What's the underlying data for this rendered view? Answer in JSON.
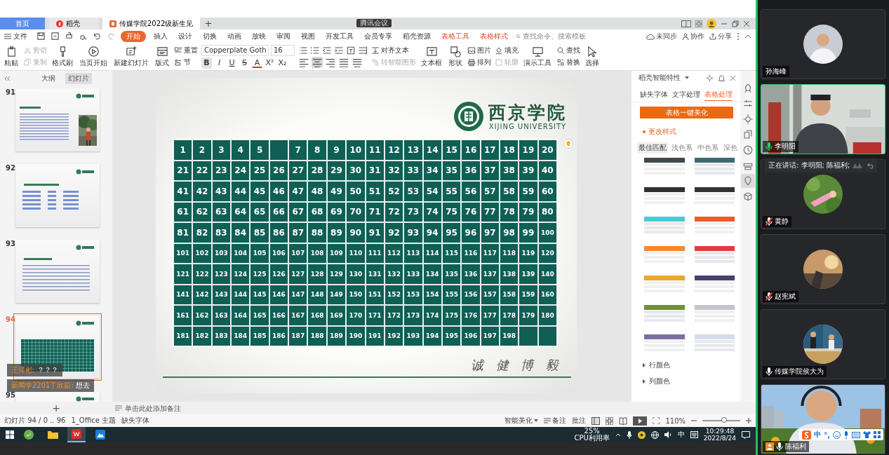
{
  "meeting": {
    "label": "腾讯会议"
  },
  "tabs": [
    {
      "label": "首页",
      "selected": false,
      "kind": "home"
    },
    {
      "label": "稻壳",
      "selected": false,
      "kind": "docer"
    },
    {
      "label": "传媒学院2022级新生见",
      "selected": true,
      "kind": "doc"
    }
  ],
  "new_tab": "+",
  "menu": {
    "file": "文件",
    "tabs": [
      {
        "label": "开始",
        "selected": true,
        "kind": "main"
      },
      {
        "label": "插入",
        "selected": false,
        "kind": "main"
      },
      {
        "label": "设计",
        "selected": false,
        "kind": "main"
      },
      {
        "label": "切换",
        "selected": false,
        "kind": "main"
      },
      {
        "label": "动画",
        "selected": false,
        "kind": "main"
      },
      {
        "label": "放映",
        "selected": false,
        "kind": "main"
      },
      {
        "label": "审阅",
        "selected": false,
        "kind": "main"
      },
      {
        "label": "视图",
        "selected": false,
        "kind": "main"
      },
      {
        "label": "开发工具",
        "selected": false,
        "kind": "main"
      },
      {
        "label": "会员专享",
        "selected": false,
        "kind": "main"
      },
      {
        "label": "稻壳资源",
        "selected": false,
        "kind": "main"
      },
      {
        "label": "表格工具",
        "selected": false,
        "kind": "context"
      },
      {
        "label": "表格样式",
        "selected": false,
        "kind": "context"
      }
    ],
    "search": {
      "placeholder": "查找命令、搜索模板"
    },
    "sync": "未同步",
    "collab": "协作",
    "share": "分享"
  },
  "ribbon": [
    {
      "kind": "big",
      "label": "粘贴",
      "disabled": false
    },
    {
      "kind": "stack",
      "items": [
        {
          "label": "剪切",
          "disabled": true
        },
        {
          "label": "复制",
          "disabled": true
        }
      ]
    },
    {
      "kind": "big",
      "label": "格式刷",
      "disabled": false
    },
    {
      "kind": "big",
      "label": "当页开始",
      "disabled": false
    },
    {
      "kind": "big",
      "label": "新建幻灯片",
      "disabled": false
    },
    {
      "kind": "big",
      "label": "版式",
      "disabled": false
    },
    {
      "kind": "stack",
      "items": [
        {
          "label": "重置",
          "disabled": false
        },
        {
          "label": "节",
          "disabled": false
        }
      ]
    },
    {
      "kind": "font",
      "font": "Copperplate Goth",
      "size": "16",
      "format": [
        {
          "label": "B",
          "selected": true
        },
        {
          "label": "I",
          "selected": false
        },
        {
          "label": "U",
          "selected": false
        },
        {
          "label": "S",
          "selected": false
        },
        {
          "label": "A",
          "selected": false
        },
        {
          "label": "X²",
          "selected": false
        },
        {
          "label": "X₂",
          "selected": false
        }
      ]
    },
    {
      "kind": "paragraph",
      "alignments": [
        {
          "selected": false
        },
        {
          "selected": true
        },
        {
          "selected": false
        },
        {
          "selected": false
        },
        {
          "selected": false
        }
      ]
    },
    {
      "kind": "stack",
      "items": [
        {
          "label": "对齐文本",
          "disabled": false
        },
        {
          "label": "转智能图形",
          "disabled": true
        }
      ]
    },
    {
      "kind": "big",
      "label": "文本框",
      "disabled": false
    },
    {
      "kind": "big",
      "label": "形状",
      "disabled": false
    },
    {
      "kind": "stack",
      "items": [
        {
          "label": "图片",
          "disabled": false
        },
        {
          "label": "排列",
          "disabled": false
        }
      ]
    },
    {
      "kind": "stack",
      "items": [
        {
          "label": "填充",
          "disabled": false
        },
        {
          "label": "轮廓",
          "disabled": true
        }
      ]
    },
    {
      "kind": "big",
      "label": "演示工具",
      "disabled": false
    },
    {
      "kind": "stack",
      "items": [
        {
          "label": "查找",
          "disabled": false
        },
        {
          "label": "替换",
          "disabled": false
        }
      ]
    },
    {
      "kind": "big",
      "label": "选择",
      "disabled": false
    }
  ],
  "outline_tabs": [
    {
      "label": "大纲",
      "selected": false
    },
    {
      "label": "幻灯片",
      "selected": true
    }
  ],
  "thumbnails": [
    {
      "number": "91",
      "selected": false
    },
    {
      "number": "92",
      "selected": false,
      "kind": "list"
    },
    {
      "number": "93",
      "selected": false,
      "kind": "text"
    },
    {
      "number": "94",
      "selected": true,
      "kind": "table"
    },
    {
      "number": "95",
      "selected": false,
      "kind": "title"
    }
  ],
  "chat": [
    {
      "name": "王泽彬:",
      "text": "？？？"
    },
    {
      "name": "新闻学2201丁欣茹:",
      "text": "想去"
    }
  ],
  "slide": {
    "logo": "西京学院",
    "logo_en": "XIJING UNIVERSITY",
    "motto": "诚 健 博 毅",
    "rows": [
      [
        "1",
        "2",
        "3",
        "4",
        "5",
        null,
        "7",
        "8",
        "9",
        "10",
        "11",
        "12",
        "13",
        "14",
        "15",
        "16",
        "17",
        "18",
        "19",
        "20"
      ],
      [
        "21",
        "22",
        "23",
        "24",
        "25",
        "26",
        "27",
        "28",
        "29",
        "30",
        "31",
        "32",
        "33",
        "34",
        "35",
        "36",
        "37",
        "38",
        "39",
        "40"
      ],
      [
        "41",
        "42",
        "43",
        "44",
        "45",
        "46",
        "47",
        "48",
        "49",
        "50",
        "51",
        "52",
        "53",
        "54",
        "55",
        "56",
        "57",
        "58",
        "59",
        "60"
      ],
      [
        "61",
        "62",
        "63",
        "64",
        "65",
        "66",
        "67",
        "68",
        "69",
        "70",
        "71",
        "72",
        "73",
        "74",
        "75",
        "76",
        "77",
        "78",
        "79",
        "80"
      ],
      [
        "81",
        "82",
        "83",
        "84",
        "85",
        "86",
        "87",
        "88",
        "89",
        "90",
        "91",
        "92",
        "93",
        "94",
        "95",
        "96",
        "97",
        "98",
        "99",
        "100"
      ],
      [
        "101",
        "102",
        "103",
        "104",
        "105",
        "106",
        "107",
        "108",
        "109",
        "110",
        "111",
        "112",
        "113",
        "114",
        "115",
        "116",
        "117",
        "118",
        "119",
        "120"
      ],
      [
        "121",
        "122",
        "123",
        "124",
        "125",
        "126",
        "127",
        "128",
        "129",
        "130",
        "131",
        "132",
        "133",
        "134",
        "135",
        "136",
        "137",
        "138",
        "139",
        "140"
      ],
      [
        "141",
        "142",
        "143",
        "144",
        "145",
        "146",
        "147",
        "148",
        "149",
        "150",
        "151",
        "152",
        "153",
        "154",
        "155",
        "156",
        "157",
        "158",
        "159",
        "160"
      ],
      [
        "161",
        "162",
        "163",
        "164",
        "165",
        "166",
        "167",
        "168",
        "169",
        "170",
        "171",
        "172",
        "173",
        "174",
        "175",
        "176",
        "177",
        "178",
        "179",
        "180"
      ],
      [
        "181",
        "182",
        "183",
        "184",
        "185",
        "186",
        "187",
        "188",
        "189",
        "190",
        "191",
        "192",
        "193",
        "194",
        "195",
        "196",
        "197",
        "198",
        null,
        null
      ]
    ]
  },
  "panel": {
    "title": "稻壳智能特性",
    "tabs": [
      {
        "label": "缺失字体",
        "selected": false
      },
      {
        "label": "文字处理",
        "selected": false
      },
      {
        "label": "表格处理",
        "selected": true
      }
    ],
    "action": "表格一键美化",
    "section": "更改样式",
    "filters": [
      {
        "label": "最佳匹配",
        "selected": true
      },
      {
        "label": "浅色系",
        "selected": false
      },
      {
        "label": "中色系",
        "selected": false
      },
      {
        "label": "深色",
        "selected": false
      }
    ],
    "styles": [
      {
        "color": "#40494c"
      },
      {
        "color": "#3e6a6f"
      },
      {
        "color": "#303030"
      },
      {
        "color": "#333333"
      },
      {
        "color": "#4cc9d2"
      },
      {
        "color": "#ec5a2c"
      },
      {
        "color": "#f08a32"
      },
      {
        "color": "#e23b3b"
      },
      {
        "color": "#e8a82a"
      },
      {
        "color": "#4b3f6c"
      },
      {
        "color": "#6f8f3a"
      },
      {
        "color": "#c2c6cc"
      },
      {
        "color": "#7c6fa0"
      },
      {
        "color": "#d6dcec"
      }
    ],
    "groups": [
      "行颜色",
      "列颜色"
    ]
  },
  "side_tools": [
    {
      "selected": false
    },
    {
      "selected": false
    },
    {
      "selected": false
    },
    {
      "selected": false
    },
    {
      "selected": false
    },
    {
      "selected": false
    },
    {
      "selected": true
    },
    {
      "selected": false
    }
  ],
  "add_slide": "+",
  "notes": {
    "placeholder": "单击此处添加备注"
  },
  "status": {
    "slide": "幻灯片 94 / 0 .. 96",
    "theme": "1_Office 主题",
    "fonts": "缺失字体",
    "beautify": "智能美化",
    "notes": "备注",
    "comments": "批注",
    "zoom": "110%",
    "zoom_slider": {
      "level": 0.58
    }
  },
  "taskbar": {
    "apps": [
      {
        "selected": false
      },
      {
        "selected": false
      },
      {
        "selected": true
      },
      {
        "selected": false
      }
    ],
    "cpu": "25%",
    "cpu_label": "CPU利用率",
    "ime": "中",
    "time": "10:29:48",
    "date": "2022/8/24"
  },
  "participants": [
    {
      "name": "孙海峰",
      "kind": "avatar",
      "mic": false,
      "muted": false,
      "talking": false,
      "selected": false,
      "host": false
    },
    {
      "name": "李明阳",
      "kind": "video",
      "mic": true,
      "muted": false,
      "talking": true,
      "selected": true,
      "host": false
    },
    {
      "name": "黄静",
      "kind": "avatar",
      "mic": true,
      "muted": true,
      "talking": false,
      "selected": false,
      "host": false
    },
    {
      "name": "赵宪斌",
      "kind": "avatar",
      "mic": true,
      "muted": true,
      "talking": false,
      "selected": false,
      "host": false
    },
    {
      "name": "传媒学院侯大为",
      "kind": "avatar",
      "mic": true,
      "muted": false,
      "talking": false,
      "selected": false,
      "host": false
    },
    {
      "name": "陈福利",
      "kind": "video",
      "mic": true,
      "muted": false,
      "talking": false,
      "selected": false,
      "host": true
    }
  ],
  "speaking": "正在讲话: 李明阳; 陈福利;",
  "ime_bar": {
    "mode": "中",
    "punct": "°,"
  }
}
